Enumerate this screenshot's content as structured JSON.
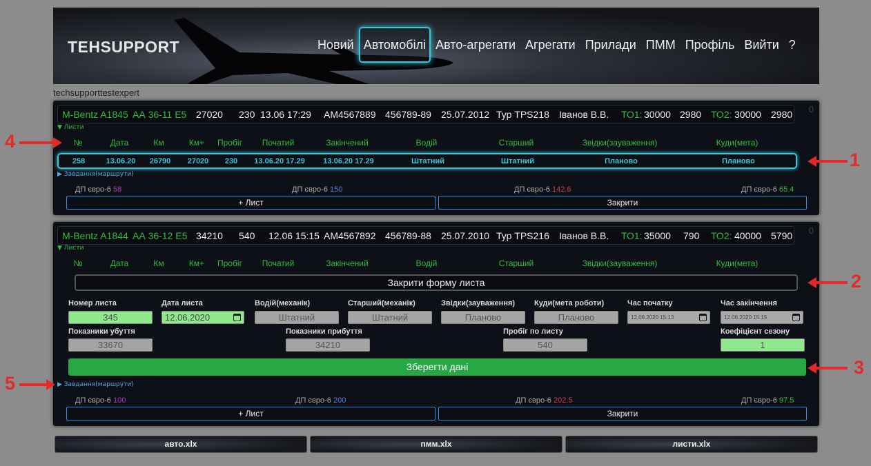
{
  "header": {
    "logo": "TEHSUPPORT",
    "nav": [
      "Новий",
      "Автомобілі",
      "Авто-агрегати",
      "Агрегати",
      "Прилади",
      "ПММ",
      "Профіль",
      "Вийти",
      "?"
    ],
    "active": "Автомобілі"
  },
  "user": "techsupporttestexpert",
  "colors": {
    "accent": "#3cc6d6",
    "green": "#2fbe3e",
    "save": "#28a745",
    "annotation": "#e32a2a"
  },
  "cars": [
    {
      "model": "M-Bentz A1845",
      "plate": "АА 36-11 Е5",
      "km": "27020",
      "v1": "230",
      "datetime": "13.06 17:29",
      "doc": "АМ4567889",
      "num": "456789-89",
      "date": "25.07.2012",
      "tyre": "Тур TPS218",
      "driver": "Іванов В.В.",
      "to1_label": "ТО1:",
      "to1": "30000",
      "to1_rest": "2980",
      "to2_label": "ТО2:",
      "to2": "30000",
      "to2_rest": "2980",
      "zero": "0",
      "sheets_toggle": "▼ Листи",
      "tasks_toggle": "▶ Завдання(маршрути)",
      "fuel": [
        {
          "label": "ДП євро-6",
          "value": "58"
        },
        {
          "label": "ДП євро-6",
          "value": "150"
        },
        {
          "label": "ДП євро-6",
          "value": "142.6"
        },
        {
          "label": "ДП євро-6",
          "value": "65.4"
        }
      ],
      "add_btn": "+ Лист",
      "close_btn": "Закрити"
    },
    {
      "model": "M-Bentz A1844",
      "plate": "АА 36-12 Е5",
      "km": "34210",
      "v1": "540",
      "datetime": "12.06 15:15",
      "doc": "АМ4567892",
      "num": "456789-88",
      "date": "25.07.2010",
      "tyre": "Тур TPS216",
      "driver": "Іванов В.В.",
      "to1_label": "ТО1:",
      "to1": "35000",
      "to1_rest": "790",
      "to2_label": "ТО2:",
      "to2": "40000",
      "to2_rest": "5790",
      "zero": "0",
      "sheets_toggle": "▼ Листи",
      "tasks_toggle": "▶ Завдання(маршрути)",
      "fuel": [
        {
          "label": "ДП євро-6",
          "value": "100"
        },
        {
          "label": "ДП євро-6",
          "value": "200"
        },
        {
          "label": "ДП євро-6",
          "value": "202.5"
        },
        {
          "label": "ДП євро-6",
          "value": "97.5"
        }
      ],
      "add_btn": "+ Лист",
      "close_btn": "Закрити"
    }
  ],
  "table_headers": [
    "№",
    "Дата",
    "Км",
    "Км+",
    "Пробіг",
    "Початий",
    "Закінчений",
    "Водій",
    "Старший",
    "Звідки(зауваження)",
    "Куди(мета)"
  ],
  "sheet_row": [
    "258",
    "13.06.20",
    "26790",
    "27020",
    "230",
    "13.06.20 17.29",
    "13.06.20 17.29",
    "Штатний",
    "Штатний",
    "Планово",
    "Планово"
  ],
  "form": {
    "close_form": "Закрити форму листа",
    "fields_row1": [
      {
        "label": "Номер листа",
        "value": "345"
      },
      {
        "label": "Дата листа",
        "value": "12.06.2020"
      },
      {
        "label": "Водій(механік)",
        "value": "Штатний"
      },
      {
        "label": "Старший(механік)",
        "value": "Штатний"
      },
      {
        "label": "Звідки(зауваження)",
        "value": "Планово"
      },
      {
        "label": "Куди(мета роботи)",
        "value": "Планово"
      },
      {
        "label": "Час початку",
        "value": "12.06.2020 15:13"
      },
      {
        "label": "Час закінчення",
        "value": "12.06.2020 15:15"
      }
    ],
    "fields_row2": [
      {
        "label": "Показники убуття",
        "value": "33670"
      },
      {
        "label": "Показники прибуття",
        "value": "34210"
      },
      {
        "label": "Пробіг по листу",
        "value": "540"
      },
      {
        "label": "Коефіцієнт сезону",
        "value": "1"
      }
    ],
    "save": "Зберегти дані"
  },
  "exports": [
    "авто.xlx",
    "пмм.xlx",
    "листи.xlx"
  ],
  "annotations": [
    "1",
    "2",
    "3",
    "4",
    "5"
  ]
}
